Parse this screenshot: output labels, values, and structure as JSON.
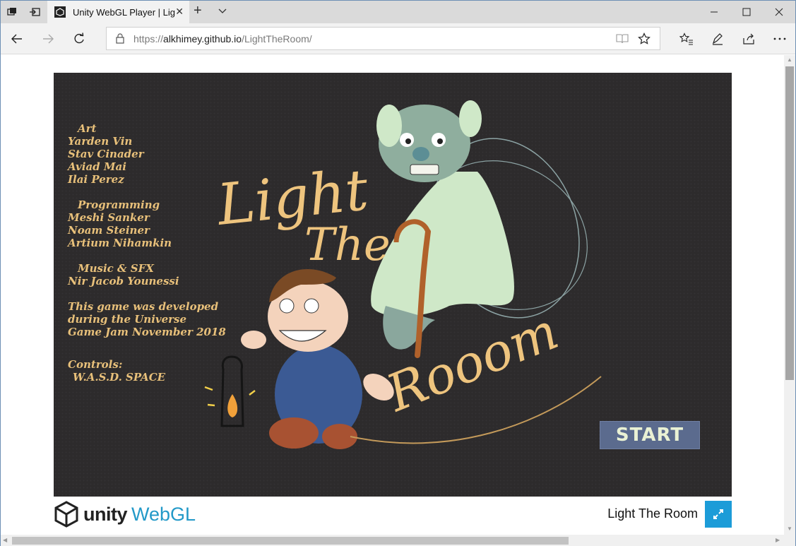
{
  "browser": {
    "tab": {
      "title": "Unity WebGL Player | Light The Room"
    },
    "address": {
      "protocol": "https://",
      "host": "alkhimey.github.io",
      "path": "/LightTheRoom/"
    }
  },
  "game": {
    "title_art": [
      "Light",
      "The",
      "Rooom"
    ],
    "credits": [
      {
        "label": "Art",
        "header": true
      },
      {
        "label": "Yarden Vin"
      },
      {
        "label": "Stav Cinader"
      },
      {
        "label": "Aviad Mai"
      },
      {
        "label": "Ilai Perez"
      },
      {
        "label": "Programming",
        "header": true
      },
      {
        "label": "Meshi Sanker"
      },
      {
        "label": "Noam Steiner"
      },
      {
        "label": "Artium Nihamkin"
      },
      {
        "label": "Music & SFX",
        "header": true
      },
      {
        "label": "Nir Jacob Younessi"
      }
    ],
    "jam_note": [
      "This game was developed",
      "during the Universe",
      "Game Jam November 2018"
    ],
    "controls_label": "Controls:",
    "controls_keys": "W.A.S.D. SPACE",
    "start_label": "START"
  },
  "footer": {
    "unity_word": "unity",
    "webgl_word": "WebGL",
    "game_title": "Light The Room"
  },
  "colors": {
    "accent": "#1c9cd8",
    "credits_text": "#e8c07a",
    "game_bg": "#2d2b2c"
  }
}
